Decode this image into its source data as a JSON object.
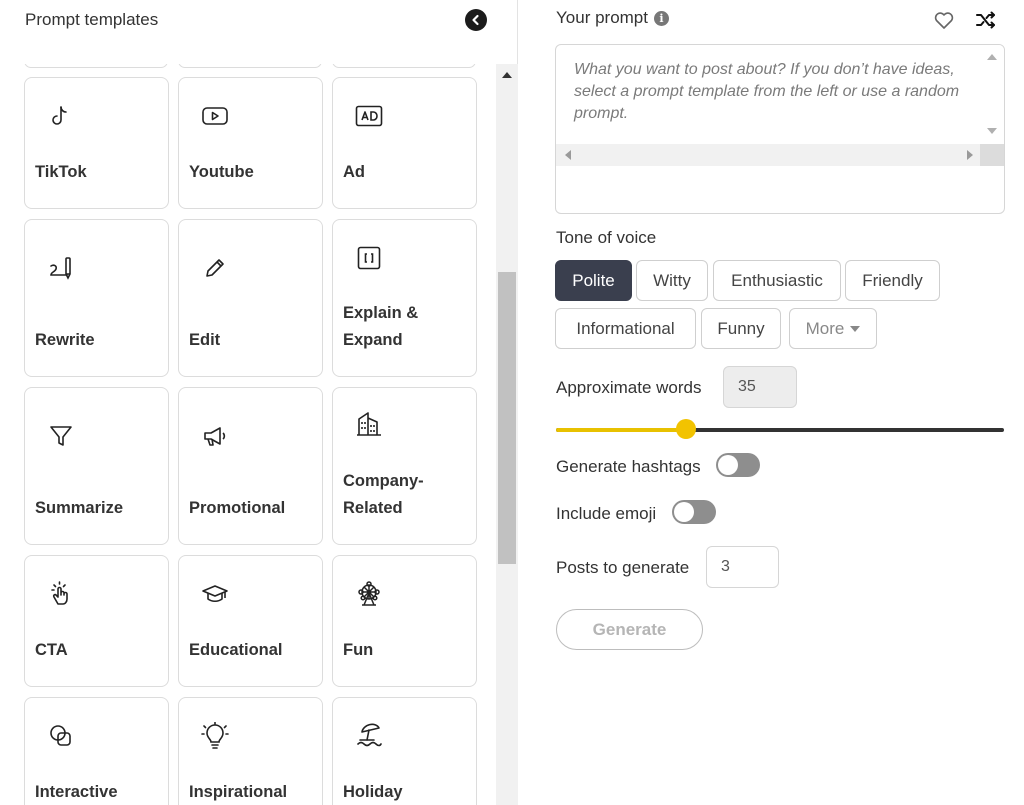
{
  "left": {
    "title": "Prompt templates",
    "collapse_icon": "chevron-left-circle-icon",
    "templates": [
      {
        "label": "TikTok",
        "icon": "tiktok-icon"
      },
      {
        "label": "Youtube",
        "icon": "youtube-icon"
      },
      {
        "label": "Ad",
        "icon": "ad-icon"
      },
      {
        "label": "Rewrite",
        "icon": "rewrite-icon"
      },
      {
        "label": "Edit",
        "icon": "pencil-icon"
      },
      {
        "label": "Explain & Expand",
        "icon": "expand-brackets-icon"
      },
      {
        "label": "Summarize",
        "icon": "funnel-icon"
      },
      {
        "label": "Promotional",
        "icon": "megaphone-icon"
      },
      {
        "label": "Company-Related",
        "icon": "building-icon"
      },
      {
        "label": "CTA",
        "icon": "tap-hand-icon"
      },
      {
        "label": "Educational",
        "icon": "graduation-cap-icon"
      },
      {
        "label": "Fun",
        "icon": "ferris-wheel-icon"
      },
      {
        "label": "Interactive",
        "icon": "overlapping-shapes-icon"
      },
      {
        "label": "Inspirational",
        "icon": "lightbulb-icon"
      },
      {
        "label": "Holiday",
        "icon": "beach-umbrella-icon"
      }
    ]
  },
  "right": {
    "prompt_title": "Your prompt",
    "prompt_placeholder": "What you want to post about? If you don’t have ideas, select a prompt template from the left or use a random prompt.",
    "tone_label": "Tone of voice",
    "tones": [
      "Polite",
      "Witty",
      "Enthusiastic",
      "Friendly",
      "Informational",
      "Funny"
    ],
    "active_tone": "Polite",
    "more_label": "More",
    "words_label": "Approximate words",
    "words_value": "35",
    "words_slider_fraction": 0.29,
    "hashtags_label": "Generate hashtags",
    "hashtags_on": false,
    "emoji_label": "Include emoji",
    "emoji_on": false,
    "posts_label": "Posts to generate",
    "posts_value": "3",
    "generate_label": "Generate"
  },
  "colors": {
    "active_tone_bg": "#3a3f4e",
    "slider_accent": "#f2c300",
    "toggle_off": "#8e8e8e"
  }
}
